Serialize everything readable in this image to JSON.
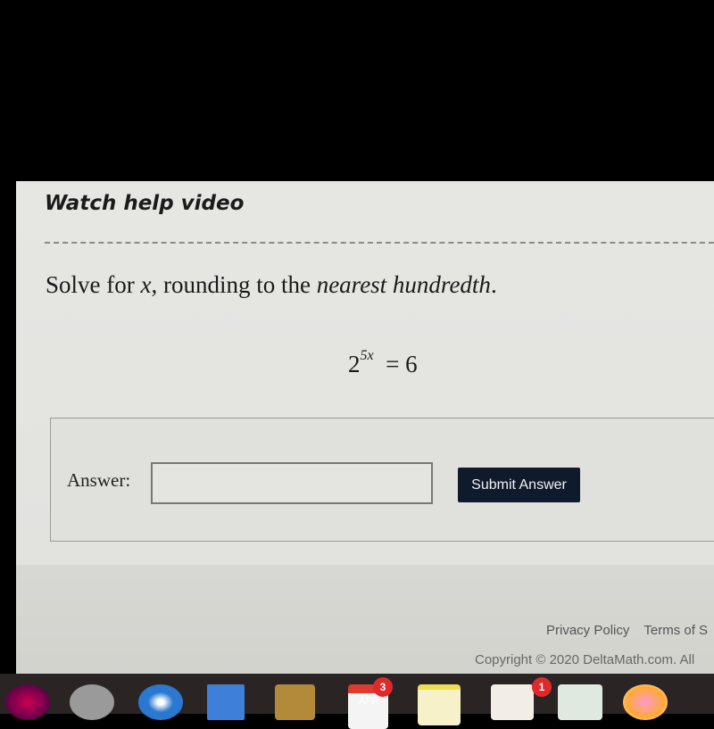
{
  "help_link": "Watch help video",
  "question": {
    "prefix": "Solve for ",
    "variable": "x",
    "middle": ", rounding to the ",
    "emphasis": "nearest hundredth",
    "suffix": "."
  },
  "equation": {
    "base": "2",
    "exponent": "5x",
    "rhs": "= 6"
  },
  "answer": {
    "label": "Answer:",
    "value": "",
    "submit_label": "Submit Answer"
  },
  "footer": {
    "links": [
      "Privacy Policy",
      "Terms of S"
    ],
    "copyright": "Copyright © 2020 DeltaMath.com. All"
  },
  "dock": {
    "calendar_month": "APR",
    "calendar_badge": "3",
    "app_badge": "1"
  }
}
